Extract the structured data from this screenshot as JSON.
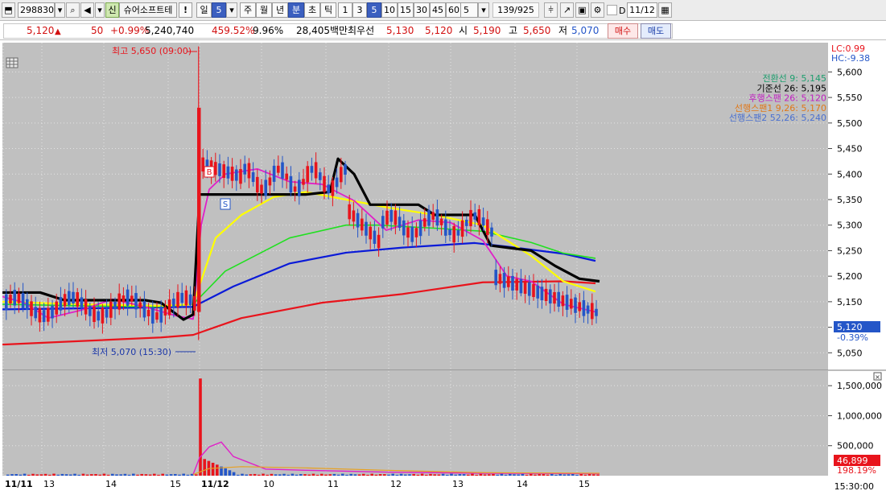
{
  "toolbar": {
    "code": "298830",
    "market_badge": "신",
    "stock_name": "슈어소프트테",
    "alert": "!",
    "period_day": "일",
    "period_count": "5",
    "period_week": "주",
    "period_month": "월",
    "period_year": "년",
    "period_minute": "분",
    "period_second": "초",
    "period_tick": "틱",
    "intervals": [
      "1",
      "3",
      "5",
      "10",
      "15",
      "30",
      "45",
      "60"
    ],
    "interval_value": "5",
    "page_counter": "139/925",
    "d_label": "D",
    "date_value": "11/12"
  },
  "quote": {
    "price": "5,120",
    "change_arrow": "▲",
    "change": "50",
    "change_pct": "+0.99%",
    "volume": "5,240,740",
    "volume_ratio": "459.52%",
    "turnover_pct": "9.96%",
    "amount": "28,405백만",
    "best_ask_label": "최우선",
    "best_ask": "5,130",
    "best_bid": "5,120",
    "open_label": "시",
    "open": "5,190",
    "high_label": "고",
    "high": "5,650",
    "low_label": "저",
    "low": "5,070",
    "buy_label": "매수",
    "sell_label": "매도"
  },
  "chart": {
    "lc": "LC:0.99",
    "hc": "HC:-9.38",
    "legend": [
      {
        "text": "전환선 9: 5,145",
        "color": "#1e9e6e"
      },
      {
        "text": "기준선 26: 5,195",
        "color": "#000000"
      },
      {
        "text": "후행스팬 26: 5,120",
        "color": "#c020c0"
      },
      {
        "text": "선행스팬1 9,26: 5,170",
        "color": "#e07818"
      },
      {
        "text": "선행스팬2 52,26: 5,240",
        "color": "#4a70d0"
      }
    ],
    "price_ticks": [
      "5,600",
      "5,550",
      "5,500",
      "5,450",
      "5,400",
      "5,350",
      "5,300",
      "5,250",
      "5,200",
      "5,150",
      "5,100",
      "5,050"
    ],
    "volume_ticks": [
      "1,500,000",
      "1,000,000",
      "500,000"
    ],
    "current_price": "5,120",
    "current_change": "-0.39%",
    "current_volume": "46,899",
    "volume_pct": "198.19%",
    "high_annotation": "최고 5,650 (09:00)",
    "low_annotation": "최저 5,070 (15:30)",
    "buy_marker": "B",
    "sell_marker": "S",
    "time_labels": [
      {
        "text": "11/11",
        "bold": true
      },
      {
        "text": "13",
        "bold": false
      },
      {
        "text": "14",
        "bold": false
      },
      {
        "text": "15",
        "bold": false
      },
      {
        "text": "11/12",
        "bold": true
      },
      {
        "text": "10",
        "bold": false
      },
      {
        "text": "11",
        "bold": false
      },
      {
        "text": "12",
        "bold": false
      },
      {
        "text": "13",
        "bold": false
      },
      {
        "text": "14",
        "bold": false
      },
      {
        "text": "15",
        "bold": false
      }
    ],
    "time_now": "15:30:00",
    "colors": {
      "up": "#e8141c",
      "down": "#2456c8",
      "ma5": "#e020c8",
      "ma10": "#ffff00",
      "ma20": "#20e020",
      "ma60": "#0a1ad8",
      "ma120": "#e8141c",
      "kijun": "#000000"
    }
  },
  "chart_data": {
    "type": "candlestick",
    "x": [
      "11/11",
      "13",
      "14",
      "15",
      "11/12",
      "10",
      "11",
      "12",
      "13",
      "14",
      "15"
    ],
    "ylim": [
      5030,
      5640
    ],
    "high": 5650,
    "low": 5070,
    "last": 5120,
    "volume_ylim": [
      0,
      1650000
    ],
    "series": [
      {
        "name": "전환선 9",
        "values": [
          5145
        ]
      },
      {
        "name": "기준선 26",
        "values": [
          5195
        ]
      },
      {
        "name": "후행스팬 26",
        "values": [
          5120
        ]
      },
      {
        "name": "선행스팬1 9,26",
        "values": [
          5170
        ]
      },
      {
        "name": "선행스팬2 52,26",
        "values": [
          5240
        ]
      }
    ],
    "ma_points": {
      "ma120": [
        [
          3,
          5066
        ],
        [
          100,
          5073
        ],
        [
          200,
          5080
        ],
        [
          240,
          5085
        ],
        [
          300,
          5118
        ],
        [
          400,
          5148
        ],
        [
          500,
          5165
        ],
        [
          600,
          5188
        ],
        [
          700,
          5190
        ],
        [
          740,
          5186
        ]
      ],
      "ma60": [
        [
          3,
          5135
        ],
        [
          100,
          5137
        ],
        [
          200,
          5139
        ],
        [
          240,
          5140
        ],
        [
          290,
          5180
        ],
        [
          360,
          5225
        ],
        [
          430,
          5246
        ],
        [
          500,
          5256
        ],
        [
          590,
          5265
        ],
        [
          630,
          5258
        ],
        [
          700,
          5244
        ],
        [
          740,
          5230
        ]
      ],
      "ma20": [
        [
          3,
          5145
        ],
        [
          100,
          5142
        ],
        [
          200,
          5140
        ],
        [
          240,
          5145
        ],
        [
          280,
          5210
        ],
        [
          360,
          5275
        ],
        [
          430,
          5300
        ],
        [
          470,
          5300
        ],
        [
          540,
          5294
        ],
        [
          600,
          5288
        ],
        [
          660,
          5266
        ],
        [
          700,
          5245
        ],
        [
          740,
          5235
        ]
      ],
      "ma10": [
        [
          3,
          5150
        ],
        [
          100,
          5145
        ],
        [
          200,
          5142
        ],
        [
          240,
          5145
        ],
        [
          268,
          5275
        ],
        [
          300,
          5320
        ],
        [
          340,
          5355
        ],
        [
          380,
          5365
        ],
        [
          430,
          5350
        ],
        [
          480,
          5335
        ],
        [
          540,
          5320
        ],
        [
          600,
          5300
        ],
        [
          660,
          5240
        ],
        [
          700,
          5190
        ],
        [
          740,
          5170
        ]
      ],
      "ma5": [
        [
          3,
          5160
        ],
        [
          30,
          5148
        ],
        [
          60,
          5118
        ],
        [
          100,
          5133
        ],
        [
          140,
          5155
        ],
        [
          180,
          5140
        ],
        [
          220,
          5122
        ],
        [
          240,
          5116
        ],
        [
          250,
          5300
        ],
        [
          260,
          5370
        ],
        [
          280,
          5400
        ],
        [
          320,
          5410
        ],
        [
          360,
          5385
        ],
        [
          400,
          5380
        ],
        [
          440,
          5348
        ],
        [
          480,
          5290
        ],
        [
          520,
          5310
        ],
        [
          560,
          5305
        ],
        [
          600,
          5270
        ],
        [
          630,
          5200
        ],
        [
          660,
          5190
        ],
        [
          700,
          5145
        ],
        [
          740,
          5130
        ]
      ],
      "kijun": [
        [
          3,
          5168
        ],
        [
          50,
          5168
        ],
        [
          80,
          5153
        ],
        [
          180,
          5153
        ],
        [
          200,
          5148
        ],
        [
          228,
          5115
        ],
        [
          240,
          5125
        ],
        [
          248,
          5360
        ],
        [
          380,
          5360
        ],
        [
          410,
          5365
        ],
        [
          420,
          5430
        ],
        [
          440,
          5400
        ],
        [
          460,
          5340
        ],
        [
          520,
          5340
        ],
        [
          540,
          5320
        ],
        [
          590,
          5320
        ],
        [
          610,
          5260
        ],
        [
          660,
          5250
        ],
        [
          690,
          5220
        ],
        [
          720,
          5195
        ],
        [
          745,
          5190
        ]
      ]
    }
  }
}
